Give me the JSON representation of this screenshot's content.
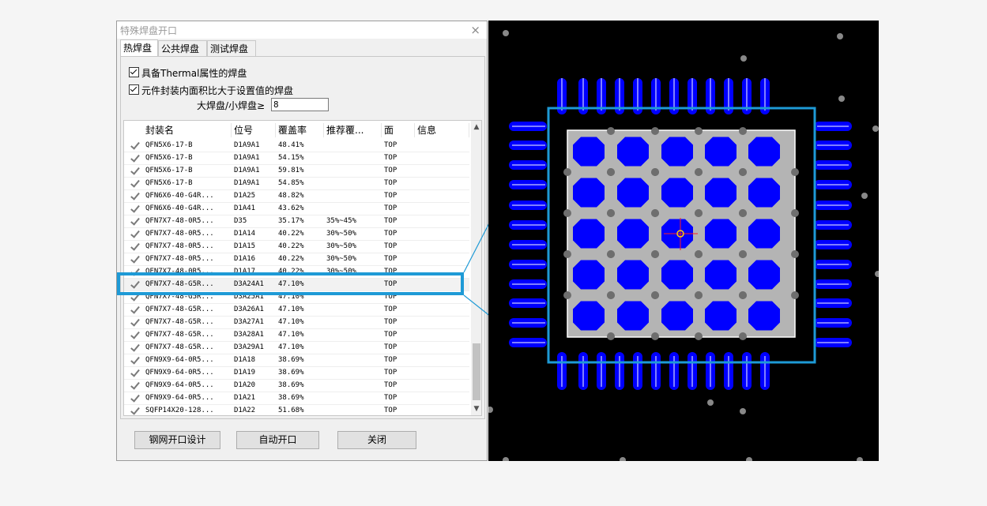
{
  "dialog": {
    "title": "特殊焊盘开口",
    "close_glyph": "×",
    "tabs": [
      "热焊盘",
      "公共焊盘",
      "测试焊盘"
    ],
    "option_thermal": "具备Thermal属性的焊盘",
    "option_ratio": "元件封装内面积比大于设置值的焊盘",
    "ratio_label": "大焊盘/小焊盘≥",
    "ratio_value": "8",
    "columns": [
      "封装名",
      "位号",
      "覆盖率",
      "推荐覆...",
      "面",
      "信息"
    ],
    "rows": [
      {
        "name": "QFN5X6-17-B",
        "ref": "D1A9A1",
        "coverage": "48.41%",
        "recommended": "",
        "side": "TOP",
        "info": ""
      },
      {
        "name": "QFN5X6-17-B",
        "ref": "D1A9A1",
        "coverage": "54.15%",
        "recommended": "",
        "side": "TOP",
        "info": ""
      },
      {
        "name": "QFN5X6-17-B",
        "ref": "D1A9A1",
        "coverage": "59.81%",
        "recommended": "",
        "side": "TOP",
        "info": ""
      },
      {
        "name": "QFN5X6-17-B",
        "ref": "D1A9A1",
        "coverage": "54.85%",
        "recommended": "",
        "side": "TOP",
        "info": ""
      },
      {
        "name": "QFN6X6-40-G4R...",
        "ref": "D1A25",
        "coverage": "48.82%",
        "recommended": "",
        "side": "TOP",
        "info": ""
      },
      {
        "name": "QFN6X6-40-G4R...",
        "ref": "D1A41",
        "coverage": "43.62%",
        "recommended": "",
        "side": "TOP",
        "info": ""
      },
      {
        "name": "QFN7X7-48-0R5...",
        "ref": "D35",
        "coverage": "35.17%",
        "recommended": "35%~45%",
        "side": "TOP",
        "info": ""
      },
      {
        "name": "QFN7X7-48-0R5...",
        "ref": "D1A14",
        "coverage": "40.22%",
        "recommended": "30%~50%",
        "side": "TOP",
        "info": ""
      },
      {
        "name": "QFN7X7-48-0R5...",
        "ref": "D1A15",
        "coverage": "40.22%",
        "recommended": "30%~50%",
        "side": "TOP",
        "info": ""
      },
      {
        "name": "QFN7X7-48-0R5...",
        "ref": "D1A16",
        "coverage": "40.22%",
        "recommended": "30%~50%",
        "side": "TOP",
        "info": ""
      },
      {
        "name": "QFN7X7-48-0R5...",
        "ref": "D1A17",
        "coverage": "40.22%",
        "recommended": "30%~50%",
        "side": "TOP",
        "info": ""
      },
      {
        "name": "QFN7X7-48-G5R...",
        "ref": "D3A24A1",
        "coverage": "47.10%",
        "recommended": "",
        "side": "TOP",
        "info": ""
      },
      {
        "name": "QFN7X7-48-G5R...",
        "ref": "D3A25A1",
        "coverage": "47.10%",
        "recommended": "",
        "side": "TOP",
        "info": ""
      },
      {
        "name": "QFN7X7-48-G5R...",
        "ref": "D3A26A1",
        "coverage": "47.10%",
        "recommended": "",
        "side": "TOP",
        "info": ""
      },
      {
        "name": "QFN7X7-48-G5R...",
        "ref": "D3A27A1",
        "coverage": "47.10%",
        "recommended": "",
        "side": "TOP",
        "info": ""
      },
      {
        "name": "QFN7X7-48-G5R...",
        "ref": "D3A28A1",
        "coverage": "47.10%",
        "recommended": "",
        "side": "TOP",
        "info": ""
      },
      {
        "name": "QFN7X7-48-G5R...",
        "ref": "D3A29A1",
        "coverage": "47.10%",
        "recommended": "",
        "side": "TOP",
        "info": ""
      },
      {
        "name": "QFN9X9-64-0R5...",
        "ref": "D1A18",
        "coverage": "38.69%",
        "recommended": "",
        "side": "TOP",
        "info": ""
      },
      {
        "name": "QFN9X9-64-0R5...",
        "ref": "D1A19",
        "coverage": "38.69%",
        "recommended": "",
        "side": "TOP",
        "info": ""
      },
      {
        "name": "QFN9X9-64-0R5...",
        "ref": "D1A20",
        "coverage": "38.69%",
        "recommended": "",
        "side": "TOP",
        "info": ""
      },
      {
        "name": "QFN9X9-64-0R5...",
        "ref": "D1A21",
        "coverage": "38.69%",
        "recommended": "",
        "side": "TOP",
        "info": ""
      },
      {
        "name": "SQFP14X20-128...",
        "ref": "D1A22",
        "coverage": "51.68%",
        "recommended": "",
        "side": "TOP",
        "info": ""
      }
    ],
    "selected_row": 11,
    "scroll_up": "▲",
    "scroll_down": "▼",
    "buttons": {
      "stencil": "钢网开口设计",
      "auto": "自动开口",
      "close": "关闭"
    }
  },
  "pcb_view": {
    "background": "#000000",
    "pad_color": "#0000ff",
    "paste_grid_color": "#b4b4b4",
    "highlight_color": "#1e9ad6",
    "crosshair_color": "#ff2020"
  }
}
